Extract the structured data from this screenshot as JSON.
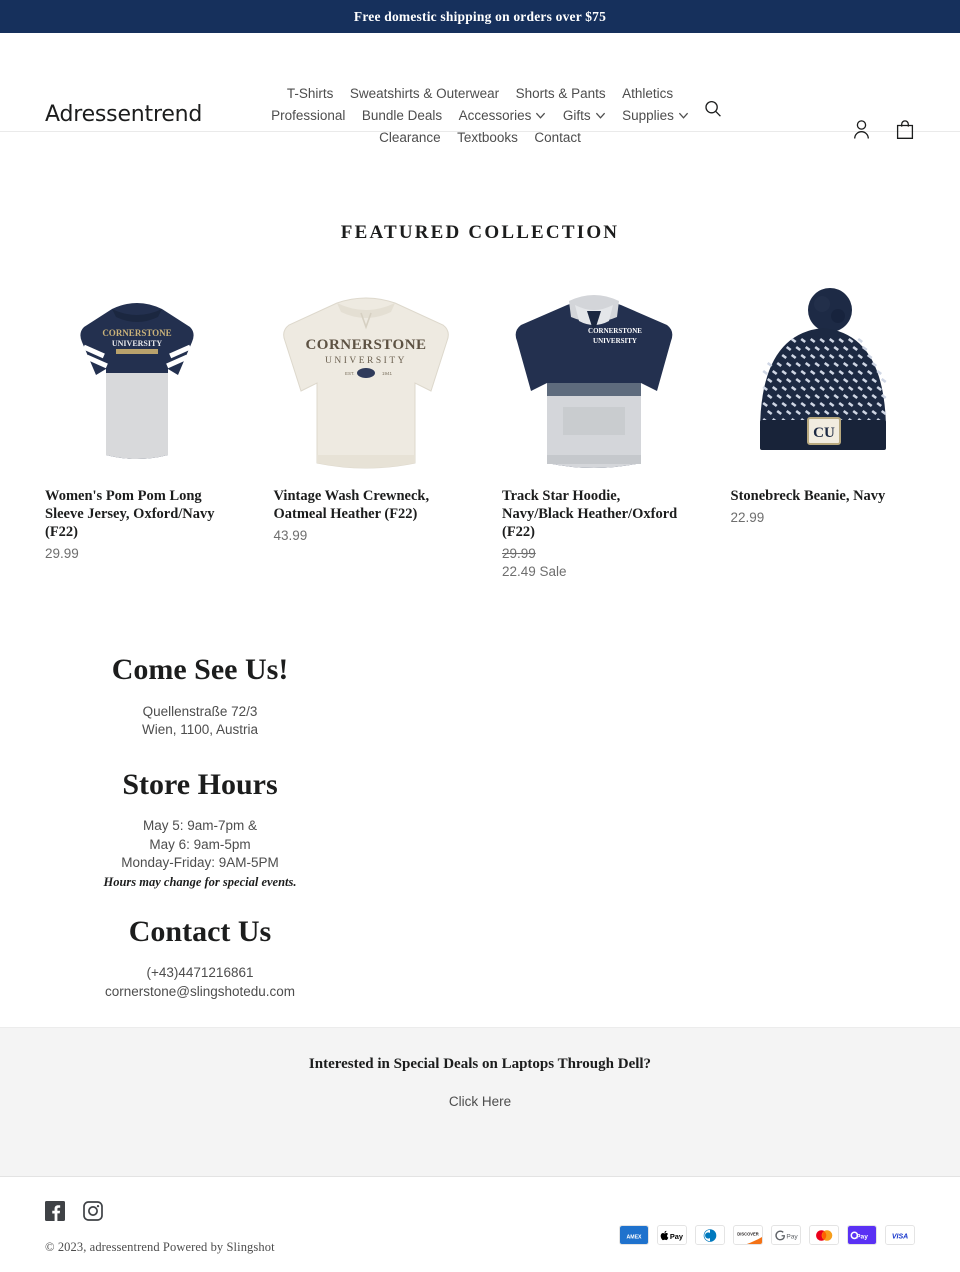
{
  "announcement": {
    "text": "Free domestic shipping on orders over $75"
  },
  "header": {
    "logo": "Adressentrend",
    "nav": [
      {
        "label": "T-Shirts",
        "dropdown": false
      },
      {
        "label": "Sweatshirts & Outerwear",
        "dropdown": false
      },
      {
        "label": "Shorts & Pants",
        "dropdown": false
      },
      {
        "label": "Athletics",
        "dropdown": false
      },
      {
        "label": "Professional",
        "dropdown": false
      },
      {
        "label": "Bundle Deals",
        "dropdown": false
      },
      {
        "label": "Accessories",
        "dropdown": true
      },
      {
        "label": "Gifts",
        "dropdown": true
      },
      {
        "label": "Supplies",
        "dropdown": true
      },
      {
        "label": "Clearance",
        "dropdown": false
      },
      {
        "label": "Textbooks",
        "dropdown": false
      },
      {
        "label": "Contact",
        "dropdown": false
      }
    ],
    "search_label": "Search",
    "account_label": "Log in",
    "cart_label": "Cart"
  },
  "featured": {
    "title": "FEATURED COLLECTION",
    "products": [
      {
        "title": "Women's Pom Pom Long Sleeve Jersey, Oxford/Navy (F22)",
        "price": "29.99",
        "compare_price": "",
        "sale_label": "",
        "on_sale": false
      },
      {
        "title": "Vintage Wash Crewneck, Oatmeal Heather (F22)",
        "price": "43.99",
        "compare_price": "",
        "sale_label": "",
        "on_sale": false
      },
      {
        "title": "Track Star Hoodie, Navy/Black Heather/Oxford (F22)",
        "price": "22.49",
        "compare_price": "29.99",
        "sale_label": "22.49 Sale",
        "on_sale": true
      },
      {
        "title": "Stonebreck Beanie, Navy",
        "price": "22.99",
        "compare_price": "",
        "sale_label": "",
        "on_sale": false
      }
    ]
  },
  "store_info": {
    "come_see_us_heading": "Come See Us!",
    "address_line1": "Quellenstraße 72/3",
    "address_line2": "Wien, 1100, Austria",
    "store_hours_heading": "Store Hours",
    "hours_line1": "May 5: 9am-7pm &",
    "hours_line2": "May 6: 9am-5pm",
    "hours_line3": "Monday-Friday: 9AM-5PM",
    "hours_note": "Hours may change for special events.",
    "contact_heading": "Contact Us",
    "phone": "(+43)4471216861",
    "email": "cornerstone@slingshotedu.com"
  },
  "promo": {
    "title": "Interested in Special Deals on Laptops Through Dell?",
    "link_label": "Click Here"
  },
  "footer": {
    "social": [
      {
        "name": "Facebook"
      },
      {
        "name": "Instagram"
      }
    ],
    "copyright": "© 2023, adressentrend Powered by Slingshot",
    "payments": [
      {
        "name": "American Express"
      },
      {
        "name": "Apple Pay"
      },
      {
        "name": "Diners Club"
      },
      {
        "name": "Discover"
      },
      {
        "name": "Google Pay"
      },
      {
        "name": "Mastercard"
      },
      {
        "name": "Shop Pay"
      },
      {
        "name": "Visa"
      }
    ]
  },
  "colors": {
    "announcement_bg": "#16305c",
    "promo_bg": "#f4f4f4",
    "text": "#1c1d1d",
    "muted": "#6e6e6e",
    "navy": "#23304f"
  }
}
